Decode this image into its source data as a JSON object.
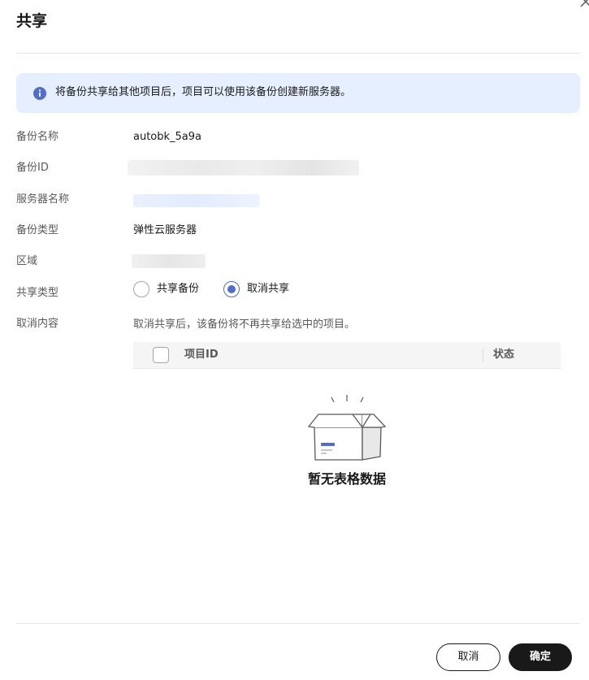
{
  "dialog": {
    "title": "共享"
  },
  "info": {
    "text": "将备份共享给其他项目后，项目可以使用该备份创建新服务器。"
  },
  "fields": {
    "backup_name_label": "备份名称",
    "backup_name_value": "autobk_5a9a",
    "backup_id_label": "备份ID",
    "server_name_label": "服务器名称",
    "backup_type_label": "备份类型",
    "backup_type_value": "弹性云服务器",
    "region_label": "区域",
    "share_type_label": "共享类型",
    "cancel_content_label": "取消内容",
    "cancel_content_value": "取消共享后，该备份将不再共享给选中的项目。"
  },
  "share_type": {
    "options": [
      "共享备份",
      "取消共享"
    ],
    "selected": "取消共享"
  },
  "table": {
    "columns": [
      "项目ID",
      "状态"
    ],
    "rows": [],
    "empty_text": "暂无表格数据"
  },
  "footer": {
    "cancel_label": "取消",
    "ok_label": "确定"
  },
  "colors": {
    "accent": "#526ecc",
    "info_bg": "#e6efff",
    "primary_button": "#191919"
  }
}
